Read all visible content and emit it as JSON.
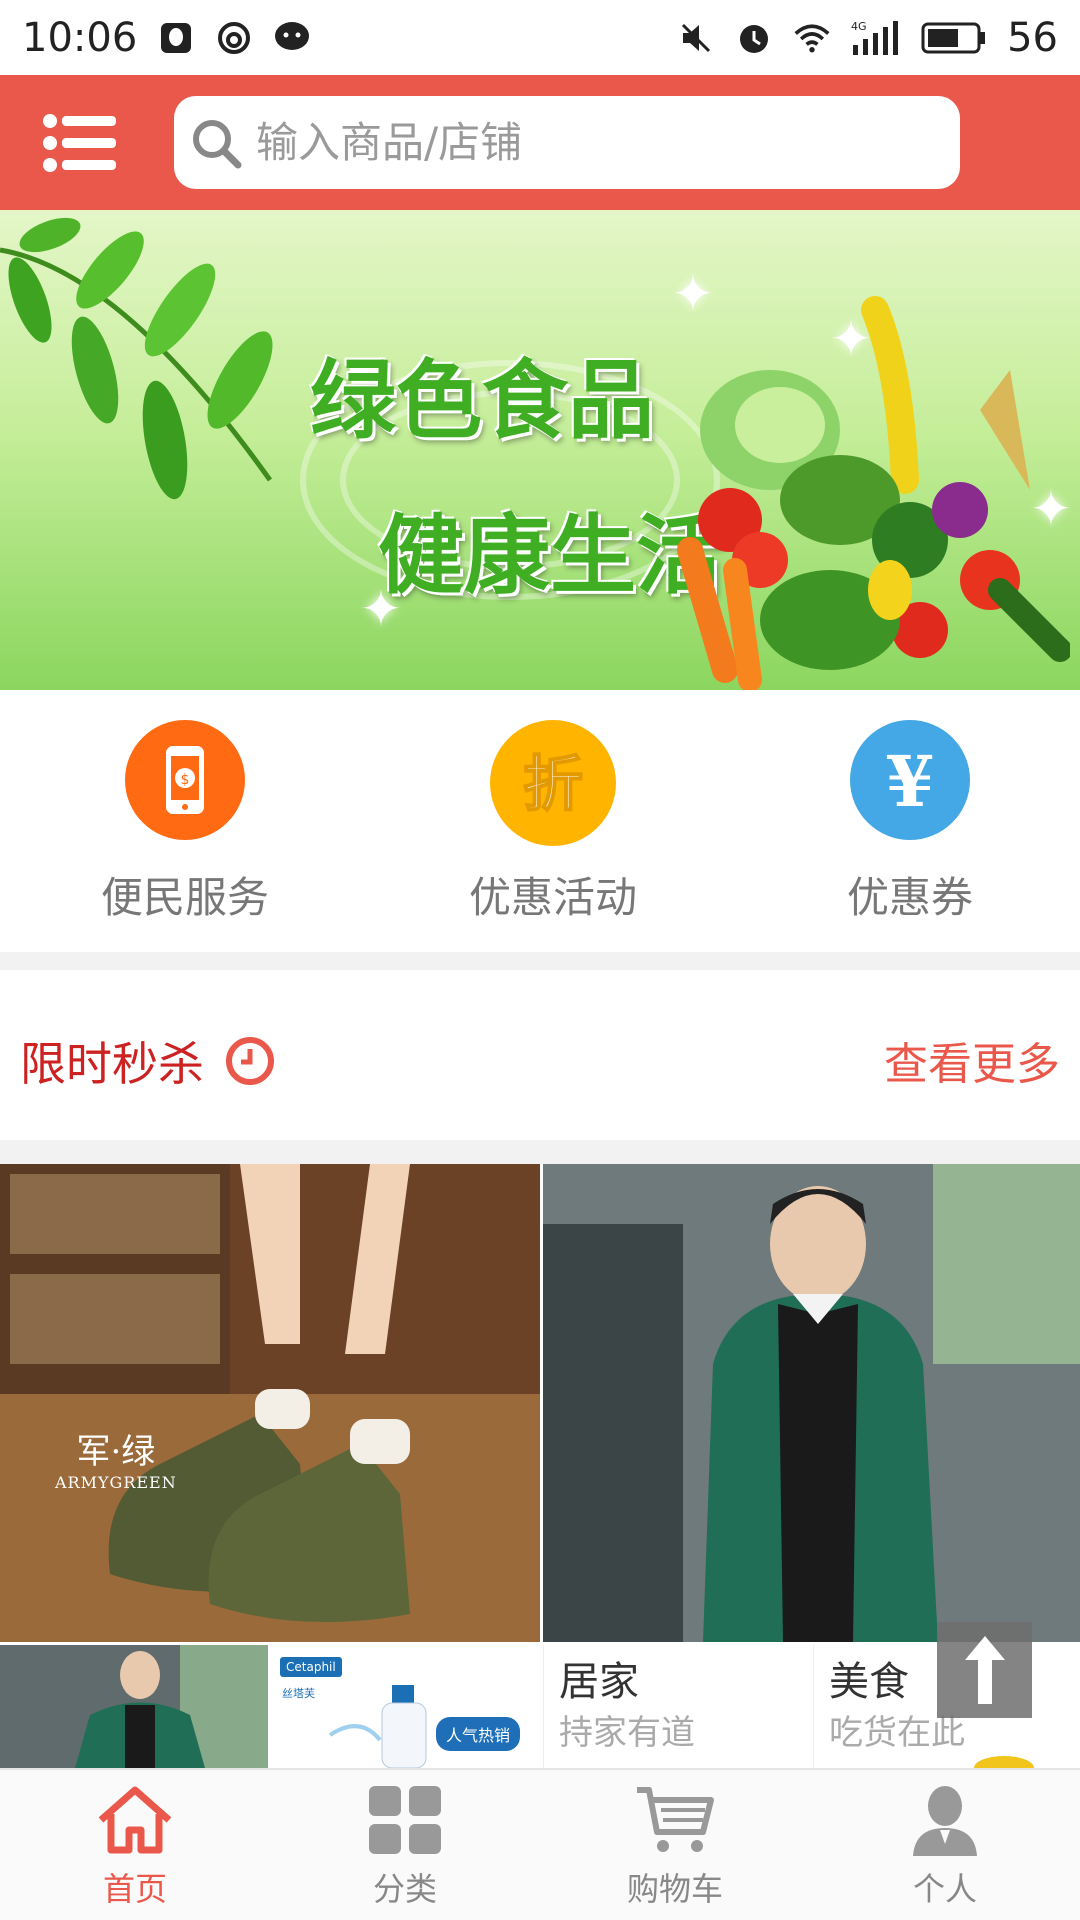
{
  "status_bar": {
    "time": "10:06",
    "battery": "56",
    "network": "4G"
  },
  "header": {
    "search_placeholder": "输入商品/店铺"
  },
  "banner": {
    "line1": "绿色食品",
    "line2": "健康生活"
  },
  "quick_links": [
    {
      "label": "便民服务",
      "icon": "phone-payment-icon",
      "color": "#ff6a13"
    },
    {
      "label": "优惠活动",
      "icon": "discount-icon",
      "color": "#ffb400"
    },
    {
      "label": "优惠券",
      "icon": "yen-coupon-icon",
      "color": "#44a7e6"
    }
  ],
  "flash_sale": {
    "title": "限时秒杀",
    "more": "查看更多"
  },
  "products": {
    "boots_brand_cn": "军·绿",
    "boots_brand_en": "ARMYGREEN",
    "cetaphil_logo": "Cetaphil",
    "cetaphil_sub": "丝塔芙",
    "hot_badge": "人气热销"
  },
  "categories": [
    {
      "title": "居家",
      "subtitle": "持家有道"
    },
    {
      "title": "美食",
      "subtitle": "吃货在此"
    }
  ],
  "tabbar": [
    {
      "label": "首页",
      "icon": "home-icon",
      "active": true
    },
    {
      "label": "分类",
      "icon": "grid-icon",
      "active": false
    },
    {
      "label": "购物车",
      "icon": "cart-icon",
      "active": false
    },
    {
      "label": "个人",
      "icon": "user-icon",
      "active": false
    }
  ],
  "colors": {
    "accent": "#e9584b",
    "flash_title": "#cc2222"
  }
}
